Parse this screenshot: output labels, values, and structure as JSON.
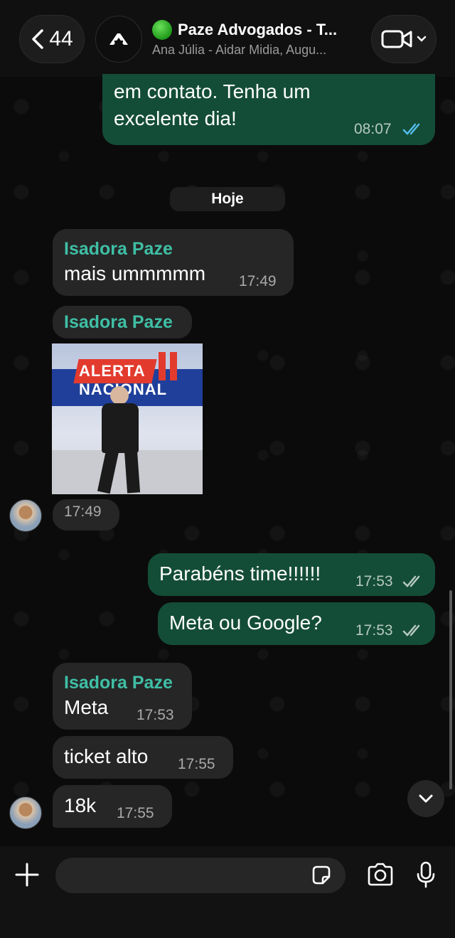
{
  "header": {
    "back_count": "44",
    "title": "Paze Advogados - T...",
    "subtitle": "Ana Júlia - Aidar Midia, Augu..."
  },
  "day_separator": "Hoje",
  "messages": [
    {
      "type": "outgoing",
      "text": "em contato. Tenha um\nexcelente dia!",
      "time": "08:07",
      "status": "read"
    },
    {
      "type": "incoming",
      "sender": "Isadora Paze",
      "text": "mais ummmmm",
      "time": "17:49"
    },
    {
      "type": "incoming-gif",
      "sender": "Isadora Paze",
      "time": "17:49",
      "gif_caption": "ALERTA NACIONAL"
    },
    {
      "type": "outgoing",
      "text": "Parabéns time!!!!!!",
      "time": "17:53",
      "status": "delivered"
    },
    {
      "type": "outgoing",
      "text": "Meta ou Google?",
      "time": "17:53",
      "status": "delivered"
    },
    {
      "type": "incoming",
      "sender": "Isadora Paze",
      "text": "Meta",
      "time": "17:53"
    },
    {
      "type": "incoming",
      "text": "ticket alto",
      "time": "17:55"
    },
    {
      "type": "incoming",
      "text": "18k",
      "time": "17:55"
    }
  ],
  "input": {
    "placeholder": "",
    "value": ""
  },
  "colors": {
    "outgoing_bubble": "#144d37",
    "incoming_bubble": "#262626",
    "sender_name": "#3fbfa5",
    "read_ticks": "#53bdeb",
    "background": "#0b0b0b"
  },
  "icons": [
    "back-chevron-icon",
    "group-logo-icon",
    "video-call-icon",
    "chevron-down-icon",
    "double-check-icon",
    "scroll-down-icon",
    "plus-icon",
    "sticker-icon",
    "camera-icon",
    "microphone-icon"
  ]
}
